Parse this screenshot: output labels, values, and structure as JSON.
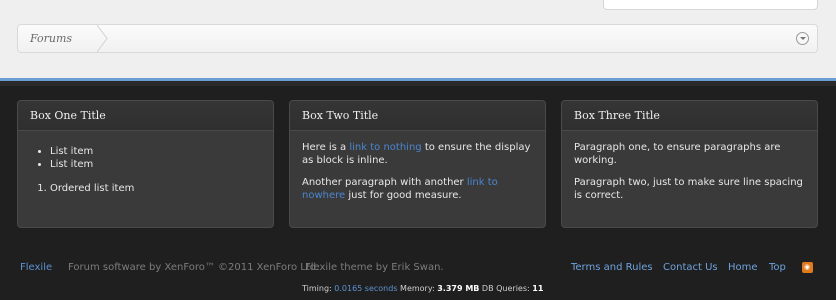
{
  "breadcrumb": {
    "forums_label": "Forums"
  },
  "boxes": [
    {
      "title": "Box One Title",
      "bullets": [
        "List item",
        "List item"
      ],
      "ordered": [
        "Ordered list item"
      ]
    },
    {
      "title": "Box Two Title",
      "p1_before": "Here is a ",
      "p1_link": "link to nothing",
      "p1_after": " to ensure the display as block is inline.",
      "p2_before": "Another paragraph with another ",
      "p2_link": "link to nowhere",
      "p2_after": " just for good measure."
    },
    {
      "title": "Box Three Title",
      "p1": "Paragraph one, to ensure paragraphs are working.",
      "p2": "Paragraph two, just to make sure line spacing is correct."
    }
  ],
  "footer": {
    "brand": "Flexile",
    "copyright": "Forum software by XenForo™ ©2011 XenForo Ltd.",
    "theme": "Flexile theme by Erik Swan.",
    "links": {
      "terms": "Terms and Rules",
      "contact": "Contact Us",
      "home": "Home",
      "top": "Top"
    },
    "rss_icon": "rss-icon",
    "debug": {
      "timing_label": "Timing: ",
      "timing_value": "0.0165 seconds",
      "memory_label": " Memory: ",
      "memory_value": "3.379 MB",
      "queries_label": " DB Queries: ",
      "queries_value": "11"
    }
  },
  "colors": {
    "accent": "#6a9fd6",
    "link": "#4a86d0",
    "background_dark": "#1f1f1f",
    "box_background": "#3a3a3a",
    "rss": "#e07a1c"
  }
}
